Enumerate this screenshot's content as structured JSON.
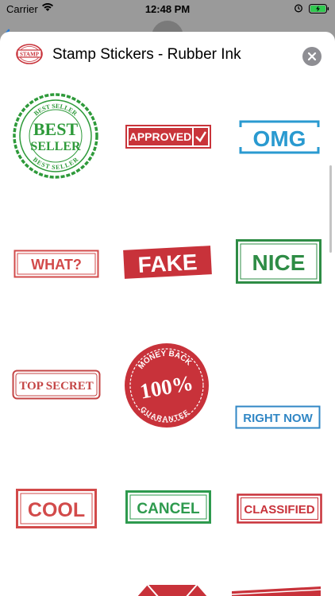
{
  "status_bar": {
    "carrier": "Carrier",
    "time": "12:48 PM",
    "wifi_icon": "wifi-icon",
    "alarm_icon": "alarm-icon",
    "battery_icon": "battery-charging-icon"
  },
  "header": {
    "title": "Stamp Stickers - Rubber Ink",
    "logo_text": "STAMP",
    "close_icon": "close-icon"
  },
  "stickers": [
    {
      "label_top": "BEST SELLER",
      "label_main": "BEST",
      "label_main2": "SELLER",
      "label_bottom": "BEST SELLER",
      "color": "#2e9a3a"
    },
    {
      "label": "APPROVED",
      "color": "#c9343a"
    },
    {
      "label": "OMG",
      "color": "#2a9ad0"
    },
    {
      "label": "WHAT?",
      "color": "#d24a4a"
    },
    {
      "label": "FAKE",
      "color": "#c8323a"
    },
    {
      "label": "NICE",
      "color": "#2e8c45"
    },
    {
      "label": "TOP SECRET",
      "color": "#c44545"
    },
    {
      "label_top": "MONEY BACK",
      "label_main": "100%",
      "label_bottom": "GUARANTEE",
      "color": "#c8323a"
    },
    {
      "label": "RIGHT NOW",
      "color": "#3187c5"
    },
    {
      "label": "COOL",
      "color": "#d24a4a"
    },
    {
      "label": "CANCEL",
      "color": "#2e9a4e"
    },
    {
      "label": "CLASSIFIED",
      "color": "#c8323a"
    }
  ],
  "colors": {
    "background_dim": "#9a9a9a",
    "sheet": "#ffffff",
    "close_button": "#8e8e93",
    "logo": "#c8323a"
  }
}
